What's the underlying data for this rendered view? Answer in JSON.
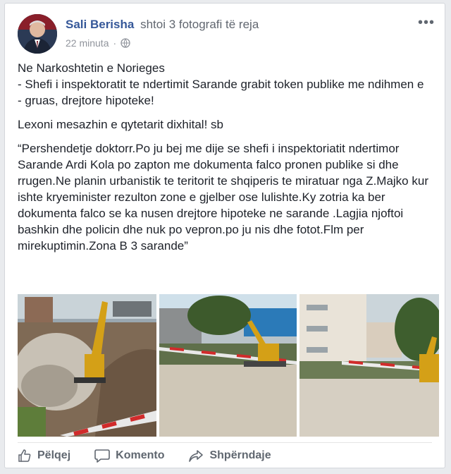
{
  "post": {
    "author": "Sali Berisha",
    "action": "shtoi 3 fotografi të reja",
    "time": "22 minuta",
    "more_label": "•••",
    "lines": [
      "Ne Narkoshtetin e Norieges",
      "- Shefi i inspektoratit te ndertimit Sarande grabit token publike me ndihmen e",
      "- gruas, drejtore hipoteke!"
    ],
    "intro": "Lexoni mesazhin e qytetarit dixhital! sb",
    "quote": "“Pershendetje doktorr.Po ju bej me dije se shefi i inspektoriatit ndertimor Sarande Ardi Kola po zapton me dokumenta falco pronen publike si dhe rrugen.Ne planin urbanistik te teritorit te shqiperis te miratuar nga Z.Majko kur ishte kryeminister rezulton zone e gjelber ose lulishte.Ky zotria ka ber dokumenta falco se ka nusen drejtore hipoteke ne sarande .Lagjia njoftoi bashkin dhe policin dhe nuk po vepron.po ju nis dhe fotot.Flm per mirekuptimin.Zona B 3 sarande”"
  },
  "actions": {
    "like": "Pëlqej",
    "comment": "Komento",
    "share": "Shpërndaje"
  },
  "colors": {
    "author": "#365899",
    "secondary": "#90949c",
    "action_text": "#606770"
  },
  "icons": [
    "globe-icon",
    "like-icon",
    "comment-icon",
    "share-icon",
    "more-icon"
  ]
}
